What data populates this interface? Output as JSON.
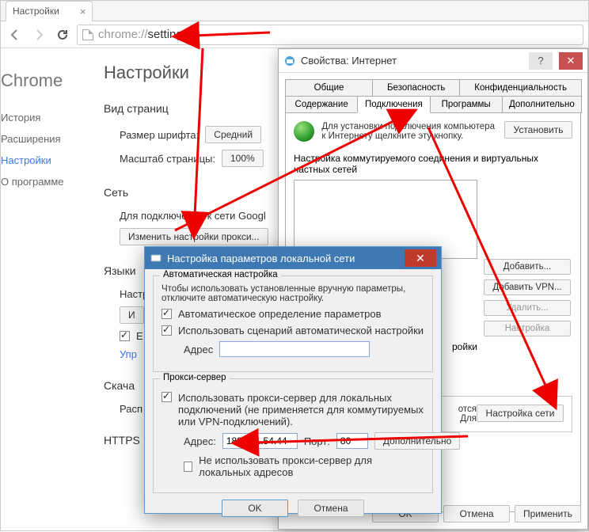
{
  "browser": {
    "tab_title": "Настройки",
    "url_gray": "chrome://",
    "url_dark": "settings"
  },
  "nav": {
    "brand": "Chrome",
    "items": [
      "История",
      "Расширения",
      "Настройки",
      "О программе"
    ]
  },
  "settings": {
    "title": "Настройки",
    "view": {
      "heading": "Вид страниц",
      "font_label": "Размер шрифта:",
      "font_btn": "Средний",
      "zoom_label": "Масштаб страницы:",
      "zoom_btn": "100%"
    },
    "network": {
      "heading": "Сеть",
      "desc": "Для подключения к сети Googl",
      "proxy_btn": "Изменить настройки прокси..."
    },
    "languages": {
      "heading": "Языки",
      "row1_label": "Настр",
      "row1_btn": "И",
      "row2_label": "E",
      "manage_link": "Упр"
    },
    "downloads": {
      "heading": "Скача",
      "row_label": "Расп"
    },
    "https": {
      "heading": "HTTPS"
    }
  },
  "inet": {
    "title": "Свойства: Интернет",
    "tabs_row1": [
      "Общие",
      "Безопасность",
      "Конфиденциальность"
    ],
    "tabs_row2": [
      "Содержание",
      "Подключения",
      "Программы",
      "Дополнительно"
    ],
    "conn_hint": "Для установки подключения компьютера к Интернету щелкните эту кнопку.",
    "install_btn": "Установить",
    "dialup_label": "Настройка коммутируемого соединения и виртуальных частных сетей",
    "side_btns": {
      "add": "Добавить...",
      "add_vpn": "Добавить VPN...",
      "delete": "Удалить...",
      "settings": "Настройка"
    },
    "radio_tail": "ройки",
    "lan_hint1": "отся",
    "lan_hint2": "Для",
    "lan_btn": "Настройка сети",
    "ok": "OK",
    "cancel": "Отмена",
    "apply": "Применить"
  },
  "lan": {
    "title": "Настройка параметров локальной сети",
    "auto_group": "Автоматическая настройка",
    "auto_hint": "Чтобы использовать установленные вручную параметры, отключите автоматическую настройку.",
    "auto_detect": "Автоматическое определение параметров",
    "use_script": "Использовать сценарий автоматической настройки",
    "addr_label": "Адрес",
    "script_addr": "",
    "proxy_group": "Прокси-сервер",
    "use_proxy": "Использовать прокси-сервер для локальных подключений (не применяется для коммутируемых или VPN-подключений).",
    "paddr_label": "Адрес:",
    "paddr": "188.151.54.44",
    "pport_label": "Порт:",
    "pport": "80",
    "advanced": "Дополнительно",
    "bypass_local": "Не использовать прокси-сервер для локальных адресов",
    "ok": "OK",
    "cancel": "Отмена"
  }
}
